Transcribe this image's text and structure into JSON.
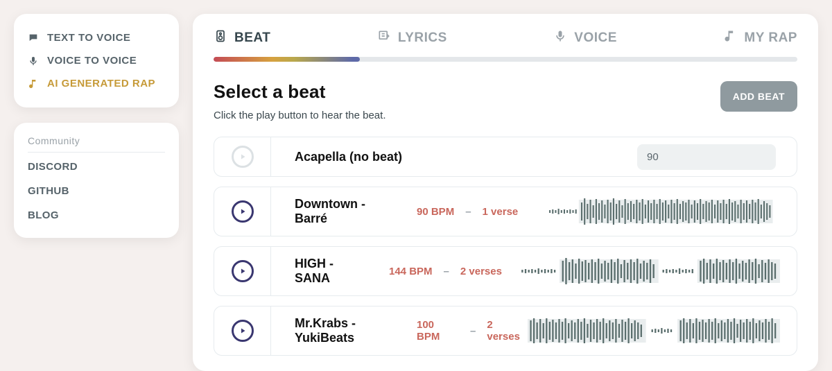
{
  "sidebar": {
    "nav": [
      {
        "label": "TEXT TO VOICE",
        "icon": "chat-icon",
        "active": false
      },
      {
        "label": "VOICE TO VOICE",
        "icon": "mic-icon",
        "active": false
      },
      {
        "label": "AI GENERATED RAP",
        "icon": "music-icon",
        "active": true
      }
    ],
    "community_label": "Community",
    "links": [
      {
        "label": "DISCORD"
      },
      {
        "label": "GITHUB"
      },
      {
        "label": "BLOG"
      }
    ]
  },
  "steps": [
    {
      "label": "BEAT",
      "icon": "speaker-icon",
      "active": true
    },
    {
      "label": "LYRICS",
      "icon": "lyrics-icon",
      "active": false
    },
    {
      "label": "VOICE",
      "icon": "mic-icon",
      "active": false
    },
    {
      "label": "MY RAP",
      "icon": "music-icon",
      "active": false
    }
  ],
  "progress_percent": 25,
  "headline": "Select a beat",
  "subline": "Click the play button to hear the beat.",
  "add_beat_label": "ADD BEAT",
  "bpm_input_value": "90",
  "beats": [
    {
      "title": "Acapella (no beat)",
      "bpm": "",
      "verses": "",
      "kind": "acapella"
    },
    {
      "title": "Downtown - Barré",
      "bpm": "90 BPM",
      "verses": "1 verse",
      "kind": "single"
    },
    {
      "title": "HIGH - SANA",
      "bpm": "144 BPM",
      "verses": "2 verses",
      "kind": "dual"
    },
    {
      "title": "Mr.Krabs - YukiBeats",
      "bpm": "100 BPM",
      "verses": "2 verses",
      "kind": "dual"
    }
  ]
}
